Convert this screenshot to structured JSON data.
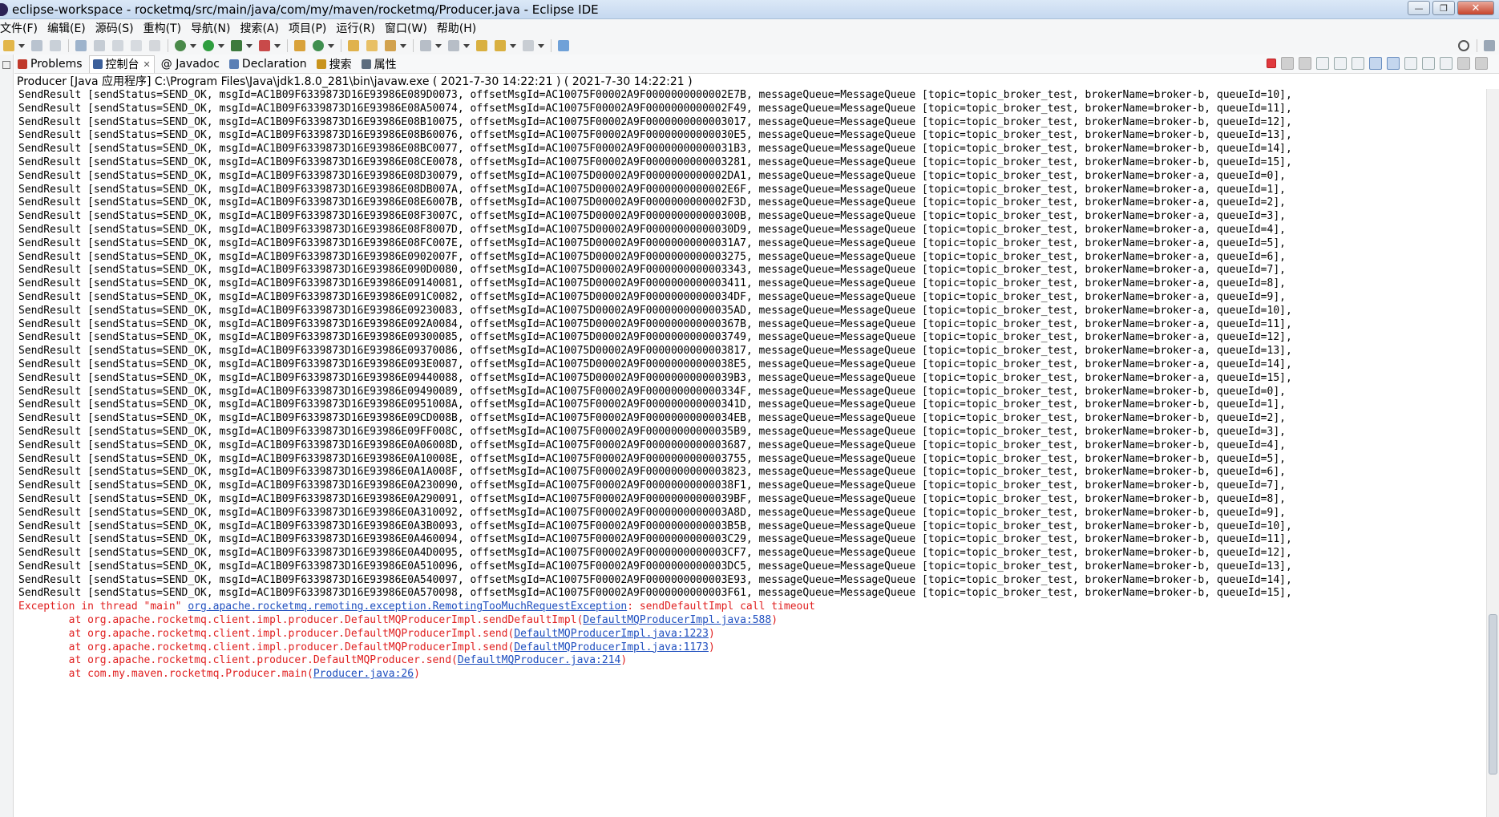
{
  "window": {
    "title": "eclipse-workspace - rocketmq/src/main/java/com/my/maven/rocketmq/Producer.java - Eclipse IDE",
    "minimize_label": "—",
    "maximize_label": "❐",
    "close_label": "✕"
  },
  "menubar": {
    "items": [
      {
        "label": "文件(F)"
      },
      {
        "label": "编辑(E)"
      },
      {
        "label": "源码(S)"
      },
      {
        "label": "重构(T)"
      },
      {
        "label": "导航(N)"
      },
      {
        "label": "搜索(A)"
      },
      {
        "label": "项目(P)"
      },
      {
        "label": "运行(R)"
      },
      {
        "label": "窗口(W)"
      },
      {
        "label": "帮助(H)"
      }
    ]
  },
  "tabs": [
    {
      "label": "Problems",
      "icon": "problems-icon",
      "color": "#c0392b"
    },
    {
      "label": "控制台",
      "icon": "console-icon",
      "color": "#3b5f9a",
      "close": "✕"
    },
    {
      "label": "@ Javadoc",
      "icon": "javadoc-icon",
      "color": "#6b8fc5"
    },
    {
      "label": "Declaration",
      "icon": "declaration-icon",
      "color": "#5a7fb5"
    },
    {
      "label": "搜索",
      "icon": "search-icon",
      "color": "#c9941d"
    },
    {
      "label": "属性",
      "icon": "properties-icon",
      "color": "#5d6d7e"
    }
  ],
  "console": {
    "description": "Producer [Java 应用程序] C:\\Program Files\\Java\\jdk1.8.0_281\\bin\\javaw.exe ( 2021-7-30 14:22:21 ) ( 2021-7-30 14:22:21 )",
    "lines": [
      "SendResult [sendStatus=SEND_OK, msgId=AC1B09F6339873D16E93986E089D0073, offsetMsgId=AC10075F00002A9F0000000000002E7B, messageQueue=MessageQueue [topic=topic_broker_test, brokerName=broker-b, queueId=10],",
      "SendResult [sendStatus=SEND_OK, msgId=AC1B09F6339873D16E93986E08A50074, offsetMsgId=AC10075F00002A9F0000000000002F49, messageQueue=MessageQueue [topic=topic_broker_test, brokerName=broker-b, queueId=11],",
      "SendResult [sendStatus=SEND_OK, msgId=AC1B09F6339873D16E93986E08B10075, offsetMsgId=AC10075F00002A9F0000000000003017, messageQueue=MessageQueue [topic=topic_broker_test, brokerName=broker-b, queueId=12],",
      "SendResult [sendStatus=SEND_OK, msgId=AC1B09F6339873D16E93986E08B60076, offsetMsgId=AC10075F00002A9F00000000000030E5, messageQueue=MessageQueue [topic=topic_broker_test, brokerName=broker-b, queueId=13],",
      "SendResult [sendStatus=SEND_OK, msgId=AC1B09F6339873D16E93986E08BC0077, offsetMsgId=AC10075F00002A9F00000000000031B3, messageQueue=MessageQueue [topic=topic_broker_test, brokerName=broker-b, queueId=14],",
      "SendResult [sendStatus=SEND_OK, msgId=AC1B09F6339873D16E93986E08CE0078, offsetMsgId=AC10075F00002A9F0000000000003281, messageQueue=MessageQueue [topic=topic_broker_test, brokerName=broker-b, queueId=15],",
      "SendResult [sendStatus=SEND_OK, msgId=AC1B09F6339873D16E93986E08D30079, offsetMsgId=AC10075D00002A9F0000000000002DA1, messageQueue=MessageQueue [topic=topic_broker_test, brokerName=broker-a, queueId=0],",
      "SendResult [sendStatus=SEND_OK, msgId=AC1B09F6339873D16E93986E08DB007A, offsetMsgId=AC10075D00002A9F0000000000002E6F, messageQueue=MessageQueue [topic=topic_broker_test, brokerName=broker-a, queueId=1],",
      "SendResult [sendStatus=SEND_OK, msgId=AC1B09F6339873D16E93986E08E6007B, offsetMsgId=AC10075D00002A9F0000000000002F3D, messageQueue=MessageQueue [topic=topic_broker_test, brokerName=broker-a, queueId=2],",
      "SendResult [sendStatus=SEND_OK, msgId=AC1B09F6339873D16E93986E08F3007C, offsetMsgId=AC10075D00002A9F000000000000300B, messageQueue=MessageQueue [topic=topic_broker_test, brokerName=broker-a, queueId=3],",
      "SendResult [sendStatus=SEND_OK, msgId=AC1B09F6339873D16E93986E08F8007D, offsetMsgId=AC10075D00002A9F00000000000030D9, messageQueue=MessageQueue [topic=topic_broker_test, brokerName=broker-a, queueId=4],",
      "SendResult [sendStatus=SEND_OK, msgId=AC1B09F6339873D16E93986E08FC007E, offsetMsgId=AC10075D00002A9F00000000000031A7, messageQueue=MessageQueue [topic=topic_broker_test, brokerName=broker-a, queueId=5],",
      "SendResult [sendStatus=SEND_OK, msgId=AC1B09F6339873D16E93986E0902007F, offsetMsgId=AC10075D00002A9F0000000000003275, messageQueue=MessageQueue [topic=topic_broker_test, brokerName=broker-a, queueId=6],",
      "SendResult [sendStatus=SEND_OK, msgId=AC1B09F6339873D16E93986E090D0080, offsetMsgId=AC10075D00002A9F0000000000003343, messageQueue=MessageQueue [topic=topic_broker_test, brokerName=broker-a, queueId=7],",
      "SendResult [sendStatus=SEND_OK, msgId=AC1B09F6339873D16E93986E09140081, offsetMsgId=AC10075D00002A9F0000000000003411, messageQueue=MessageQueue [topic=topic_broker_test, brokerName=broker-a, queueId=8],",
      "SendResult [sendStatus=SEND_OK, msgId=AC1B09F6339873D16E93986E091C0082, offsetMsgId=AC10075D00002A9F00000000000034DF, messageQueue=MessageQueue [topic=topic_broker_test, brokerName=broker-a, queueId=9],",
      "SendResult [sendStatus=SEND_OK, msgId=AC1B09F6339873D16E93986E09230083, offsetMsgId=AC10075D00002A9F00000000000035AD, messageQueue=MessageQueue [topic=topic_broker_test, brokerName=broker-a, queueId=10],",
      "SendResult [sendStatus=SEND_OK, msgId=AC1B09F6339873D16E93986E092A0084, offsetMsgId=AC10075D00002A9F000000000000367B, messageQueue=MessageQueue [topic=topic_broker_test, brokerName=broker-a, queueId=11],",
      "SendResult [sendStatus=SEND_OK, msgId=AC1B09F6339873D16E93986E09300085, offsetMsgId=AC10075D00002A9F0000000000003749, messageQueue=MessageQueue [topic=topic_broker_test, brokerName=broker-a, queueId=12],",
      "SendResult [sendStatus=SEND_OK, msgId=AC1B09F6339873D16E93986E09370086, offsetMsgId=AC10075D00002A9F0000000000003817, messageQueue=MessageQueue [topic=topic_broker_test, brokerName=broker-a, queueId=13],",
      "SendResult [sendStatus=SEND_OK, msgId=AC1B09F6339873D16E93986E093E0087, offsetMsgId=AC10075D00002A9F00000000000038E5, messageQueue=MessageQueue [topic=topic_broker_test, brokerName=broker-a, queueId=14],",
      "SendResult [sendStatus=SEND_OK, msgId=AC1B09F6339873D16E93986E09440088, offsetMsgId=AC10075D00002A9F00000000000039B3, messageQueue=MessageQueue [topic=topic_broker_test, brokerName=broker-a, queueId=15],",
      "SendResult [sendStatus=SEND_OK, msgId=AC1B09F6339873D16E93986E09490089, offsetMsgId=AC10075F00002A9F000000000000334F, messageQueue=MessageQueue [topic=topic_broker_test, brokerName=broker-b, queueId=0],",
      "SendResult [sendStatus=SEND_OK, msgId=AC1B09F6339873D16E93986E0951008A, offsetMsgId=AC10075F00002A9F000000000000341D, messageQueue=MessageQueue [topic=topic_broker_test, brokerName=broker-b, queueId=1],",
      "SendResult [sendStatus=SEND_OK, msgId=AC1B09F6339873D16E93986E09CD008B, offsetMsgId=AC10075F00002A9F00000000000034EB, messageQueue=MessageQueue [topic=topic_broker_test, brokerName=broker-b, queueId=2],",
      "SendResult [sendStatus=SEND_OK, msgId=AC1B09F6339873D16E93986E09FF008C, offsetMsgId=AC10075F00002A9F00000000000035B9, messageQueue=MessageQueue [topic=topic_broker_test, brokerName=broker-b, queueId=3],",
      "SendResult [sendStatus=SEND_OK, msgId=AC1B09F6339873D16E93986E0A06008D, offsetMsgId=AC10075F00002A9F0000000000003687, messageQueue=MessageQueue [topic=topic_broker_test, brokerName=broker-b, queueId=4],",
      "SendResult [sendStatus=SEND_OK, msgId=AC1B09F6339873D16E93986E0A10008E, offsetMsgId=AC10075F00002A9F0000000000003755, messageQueue=MessageQueue [topic=topic_broker_test, brokerName=broker-b, queueId=5],",
      "SendResult [sendStatus=SEND_OK, msgId=AC1B09F6339873D16E93986E0A1A008F, offsetMsgId=AC10075F00002A9F0000000000003823, messageQueue=MessageQueue [topic=topic_broker_test, brokerName=broker-b, queueId=6],",
      "SendResult [sendStatus=SEND_OK, msgId=AC1B09F6339873D16E93986E0A230090, offsetMsgId=AC10075F00002A9F00000000000038F1, messageQueue=MessageQueue [topic=topic_broker_test, brokerName=broker-b, queueId=7],",
      "SendResult [sendStatus=SEND_OK, msgId=AC1B09F6339873D16E93986E0A290091, offsetMsgId=AC10075F00002A9F00000000000039BF, messageQueue=MessageQueue [topic=topic_broker_test, brokerName=broker-b, queueId=8],",
      "SendResult [sendStatus=SEND_OK, msgId=AC1B09F6339873D16E93986E0A310092, offsetMsgId=AC10075F00002A9F0000000000003A8D, messageQueue=MessageQueue [topic=topic_broker_test, brokerName=broker-b, queueId=9],",
      "SendResult [sendStatus=SEND_OK, msgId=AC1B09F6339873D16E93986E0A3B0093, offsetMsgId=AC10075F00002A9F0000000000003B5B, messageQueue=MessageQueue [topic=topic_broker_test, brokerName=broker-b, queueId=10],",
      "SendResult [sendStatus=SEND_OK, msgId=AC1B09F6339873D16E93986E0A460094, offsetMsgId=AC10075F00002A9F0000000000003C29, messageQueue=MessageQueue [topic=topic_broker_test, brokerName=broker-b, queueId=11],",
      "SendResult [sendStatus=SEND_OK, msgId=AC1B09F6339873D16E93986E0A4D0095, offsetMsgId=AC10075F00002A9F0000000000003CF7, messageQueue=MessageQueue [topic=topic_broker_test, brokerName=broker-b, queueId=12],",
      "SendResult [sendStatus=SEND_OK, msgId=AC1B09F6339873D16E93986E0A510096, offsetMsgId=AC10075F00002A9F0000000000003DC5, messageQueue=MessageQueue [topic=topic_broker_test, brokerName=broker-b, queueId=13],",
      "SendResult [sendStatus=SEND_OK, msgId=AC1B09F6339873D16E93986E0A540097, offsetMsgId=AC10075F00002A9F0000000000003E93, messageQueue=MessageQueue [topic=topic_broker_test, brokerName=broker-b, queueId=14],",
      "SendResult [sendStatus=SEND_OK, msgId=AC1B09F6339873D16E93986E0A570098, offsetMsgId=AC10075F00002A9F0000000000003F61, messageQueue=MessageQueue [topic=topic_broker_test, brokerName=broker-b, queueId=15],"
    ],
    "exception": {
      "prefix": "Exception in thread \"main\" ",
      "class_link": "org.apache.rocketmq.remoting.exception.RemotingTooMuchRequestException",
      "message": ": sendDefaultImpl call timeout",
      "frames": [
        {
          "prefix": "\tat org.apache.rocketmq.client.impl.producer.DefaultMQProducerImpl.sendDefaultImpl(",
          "link": "DefaultMQProducerImpl.java:588",
          "suffix": ")"
        },
        {
          "prefix": "\tat org.apache.rocketmq.client.impl.producer.DefaultMQProducerImpl.send(",
          "link": "DefaultMQProducerImpl.java:1223",
          "suffix": ")"
        },
        {
          "prefix": "\tat org.apache.rocketmq.client.impl.producer.DefaultMQProducerImpl.send(",
          "link": "DefaultMQProducerImpl.java:1173",
          "suffix": ")"
        },
        {
          "prefix": "\tat org.apache.rocketmq.client.producer.DefaultMQProducer.send(",
          "link": "DefaultMQProducer.java:214",
          "suffix": ")"
        },
        {
          "prefix": "\tat com.my.maven.rocketmq.Producer.main(",
          "link": "Producer.java:26",
          "suffix": ")"
        }
      ]
    }
  },
  "colors": {
    "error_text": "#e02020",
    "link": "#1f4fbf",
    "terminate_button": "#e0393e"
  }
}
